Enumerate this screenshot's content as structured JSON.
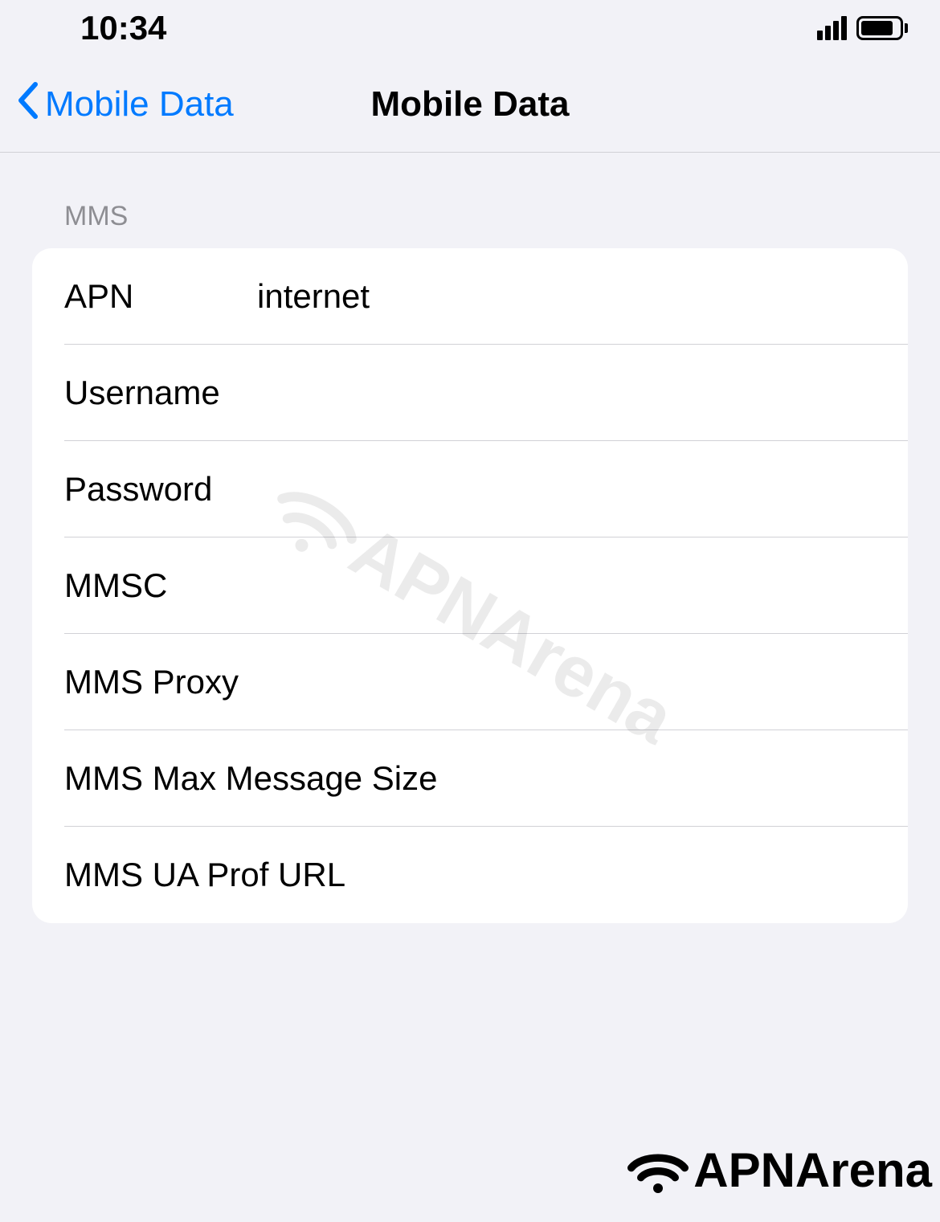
{
  "status_bar": {
    "time": "10:34"
  },
  "nav": {
    "back_label": "Mobile Data",
    "title": "Mobile Data"
  },
  "section": {
    "header": "MMS"
  },
  "fields": {
    "apn": {
      "label": "APN",
      "value": "internet"
    },
    "username": {
      "label": "Username",
      "value": ""
    },
    "password": {
      "label": "Password",
      "value": ""
    },
    "mmsc": {
      "label": "MMSC",
      "value": ""
    },
    "mms_proxy": {
      "label": "MMS Proxy",
      "value": ""
    },
    "mms_max_size": {
      "label": "MMS Max Message Size",
      "value": ""
    },
    "mms_ua_prof": {
      "label": "MMS UA Prof URL",
      "value": ""
    }
  },
  "watermark": {
    "text": "APNArena"
  }
}
